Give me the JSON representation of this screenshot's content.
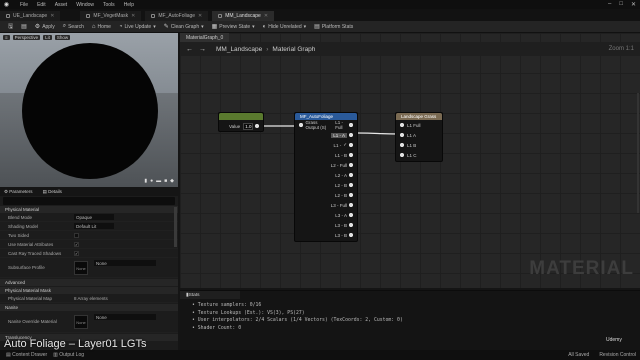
{
  "menu": [
    "File",
    "Edit",
    "Asset",
    "Window",
    "Tools",
    "Help"
  ],
  "tabs": [
    {
      "label": "UE_Landscape",
      "active": false
    },
    {
      "label": "MF_VegetMask",
      "active": false
    },
    {
      "label": "MF_AutoFoliage",
      "active": false
    },
    {
      "label": "MM_Landscape",
      "active": true
    }
  ],
  "toolbar": {
    "apply": "Apply",
    "search": "Search",
    "home": "Home",
    "live_update": "Live Update",
    "clean_graph": "Clean Graph",
    "preview_state": "Preview State",
    "hide_unrelated": "Hide Unrelated",
    "stats": "Stats",
    "platform_stats": "Platform Stats"
  },
  "viewport": {
    "chips": [
      "Perspective",
      "Lit",
      "Show"
    ]
  },
  "details": {
    "tabs": [
      "Parameters",
      "Details"
    ],
    "sections": {
      "material": "Physical Material",
      "advanced": "Advanced",
      "physical_mask": "Physical Material Mask",
      "nanite": "Nanite",
      "translucency": "Translucency"
    },
    "props": [
      {
        "label": "Blend Mode",
        "value": "Opaque"
      },
      {
        "label": "Shading Model",
        "value": "Default Lit"
      },
      {
        "label": "Two Sided",
        "value": ""
      },
      {
        "label": "Use Material Attributes",
        "value": "✓"
      },
      {
        "label": "Cast Ray Traced Shadows",
        "value": "✓"
      },
      {
        "label": "Subsurface Profile",
        "value": "None"
      }
    ],
    "physical_material_map": {
      "label": "Physical Material Map",
      "value": "8 Array elements"
    },
    "nanite_override": {
      "label": "Nanite Override Material",
      "value": "None"
    },
    "none_thumb": "None"
  },
  "graph": {
    "tab": "MaterialGraph_0",
    "breadcrumb": [
      "MM_Landscape",
      "Material Graph"
    ],
    "zoom": "Zoom 1:1",
    "watermark": "MATERIAL"
  },
  "nodes": {
    "value": {
      "title": "",
      "label": "Value",
      "value": "1.0"
    },
    "autofoliage": {
      "title": "MF_AutoFoliage",
      "input": "Grass Output (S)",
      "outputs": [
        "L1 - Full",
        "L1 - A",
        "L1 -",
        "L1 - B",
        "L2 - Full",
        "L2 - A",
        "L2 - B",
        "L2 - B",
        "L3 - Full",
        "L3 - A",
        "L3 - B",
        "L3 - B"
      ]
    },
    "grass": {
      "title": "Landscape Grass",
      "outputs": [
        "L1 Full",
        "L1 A",
        "L1 B",
        "L1 C"
      ]
    }
  },
  "stats": {
    "tab": "Stats",
    "lines": [
      "Texture samplers: 0/16",
      "Texture Lookups (Est.): VS(3), PS(27)",
      "User interpolators: 2/4 Scalars (1/4 Vectors) (TexCoords: 2, Custom: 0)",
      "Shader Count: 0"
    ]
  },
  "bottom": {
    "content_drawer": "Content Drawer",
    "output_log": "Output Log",
    "all_saved": "All Saved",
    "revision_control": "Revision Control"
  },
  "subtitle": "Auto Foliage – Layer01 LGTs",
  "brand": "Udemy"
}
